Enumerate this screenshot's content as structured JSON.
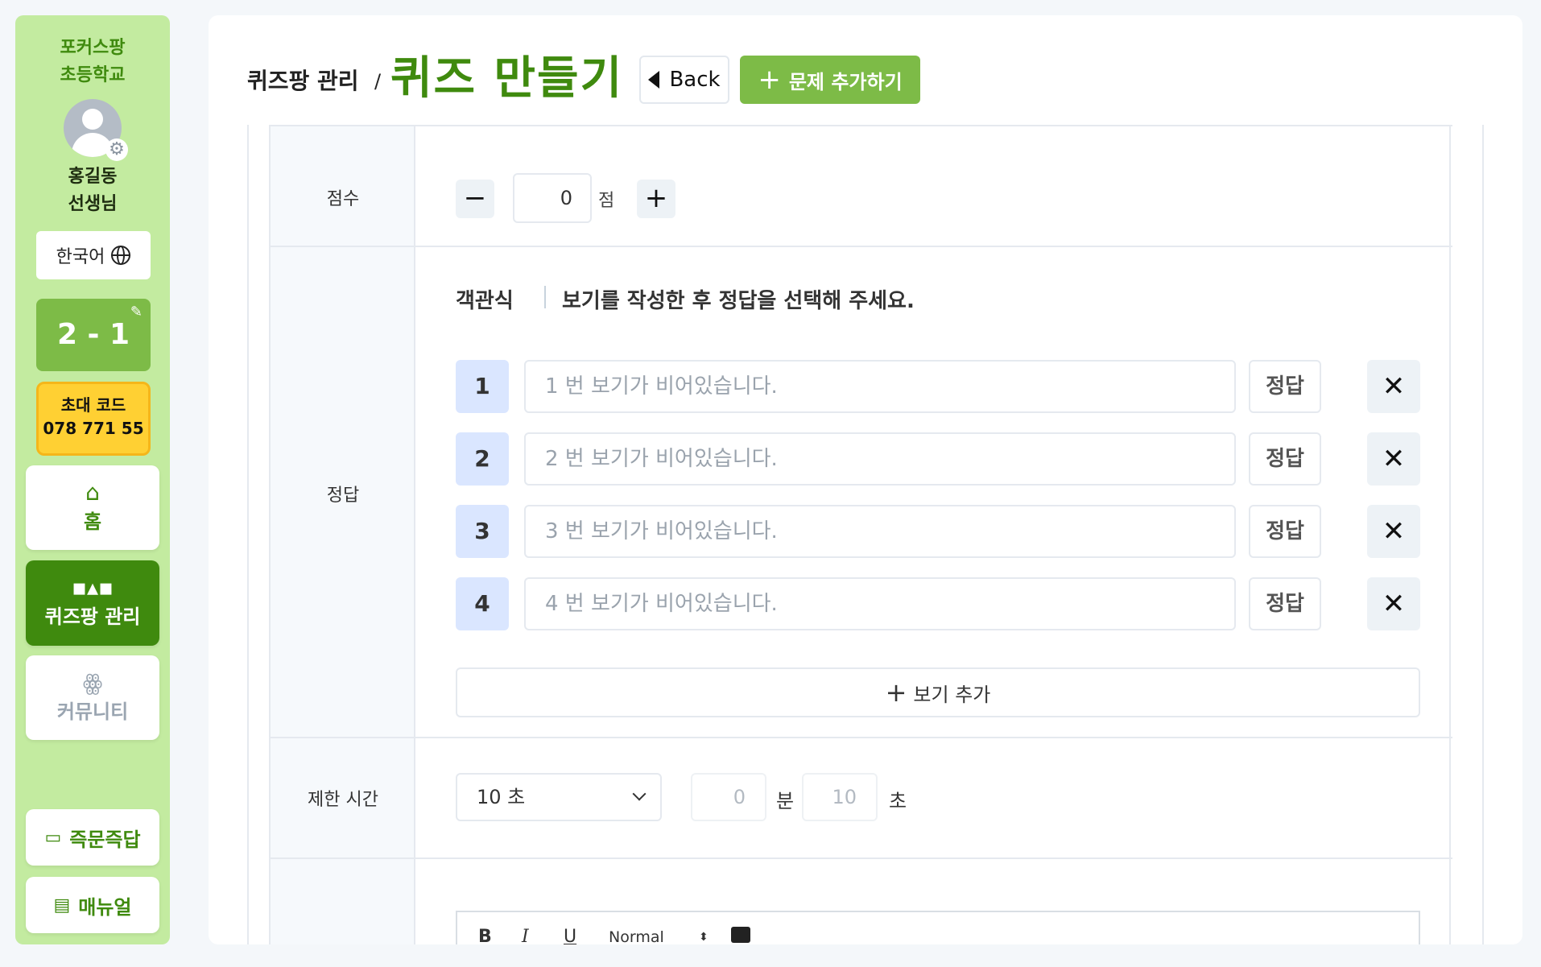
{
  "sidebar": {
    "school_line1": "포커스팡",
    "school_line2": "초등학교",
    "teacher_line1": "홍길동",
    "teacher_line2": "선생님",
    "language": "한국어",
    "class_name": "2 - 1",
    "invite_label": "초대 코드",
    "invite_code": "078 771 55",
    "nav": {
      "home": "홈",
      "quiz": "퀴즈팡 관리",
      "community": "커뮤니티"
    },
    "qa": "즉문즉답",
    "manual": "매뉴얼"
  },
  "header": {
    "breadcrumb": "퀴즈팡 관리",
    "separator": "/",
    "title": "퀴즈 만들기",
    "back": "Back",
    "add_question": "문제 추가하기"
  },
  "form": {
    "score": {
      "label": "점수",
      "value": "0",
      "unit": "점",
      "minus": "−",
      "plus": "+"
    },
    "answer": {
      "label": "정답",
      "type": "객관식",
      "hint": "보기를 작성한 후 정답을 선택해 주세요.",
      "answer_button": "정답",
      "options": [
        {
          "num": "1",
          "placeholder": "1 번 보기가 비어있습니다."
        },
        {
          "num": "2",
          "placeholder": "2 번 보기가 비어있습니다."
        },
        {
          "num": "3",
          "placeholder": "3 번 보기가 비어있습니다."
        },
        {
          "num": "4",
          "placeholder": "4 번 보기가 비어있습니다."
        }
      ],
      "add_option": "보기 추가"
    },
    "time": {
      "label": "제한 시간",
      "selected": "10 초",
      "minutes": "0",
      "minutes_unit": "분",
      "seconds": "10",
      "seconds_unit": "초"
    },
    "editor": {
      "bold": "B",
      "italic": "I",
      "underline": "U",
      "format": "Normal"
    }
  },
  "colors": {
    "brand_green": "#7dbb47",
    "dark_green": "#3f8a0e",
    "sidebar_bg": "#c3eba0",
    "invite_yellow": "#ffd033"
  }
}
